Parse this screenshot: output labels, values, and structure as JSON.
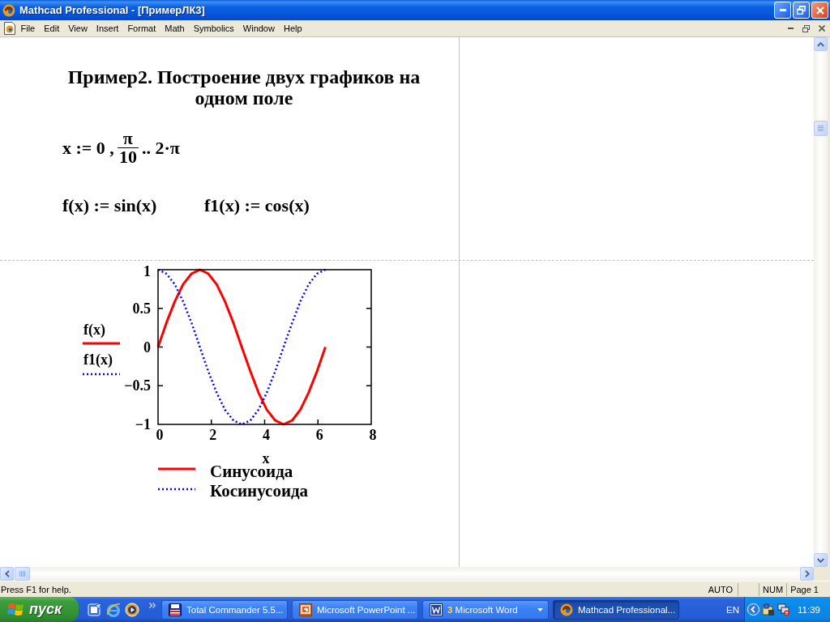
{
  "window": {
    "title": "Mathcad Professional - [ПримерЛК3]"
  },
  "menu": [
    "File",
    "Edit",
    "View",
    "Insert",
    "Format",
    "Math",
    "Symbolics",
    "Window",
    "Help"
  ],
  "worksheet": {
    "heading": "Пример2. Построение двух графиков на одном поле",
    "range_definition": {
      "prefix": "x := 0 ,",
      "numerator": "π",
      "denominator": "10",
      "suffix": ".. 2·π"
    },
    "definitions": [
      "f(x) := sin(x)",
      "f1(x) := cos(x)"
    ],
    "plot": {
      "y_axis_labels": [
        "f(x)",
        "f1(x)"
      ],
      "chart_data": {
        "type": "line",
        "xlabel": "x",
        "x": [
          0,
          0.31,
          0.63,
          0.94,
          1.26,
          1.57,
          1.88,
          2.2,
          2.51,
          2.83,
          3.14,
          3.46,
          3.77,
          4.08,
          4.4,
          4.71,
          5.03,
          5.34,
          5.65,
          5.97,
          6.28
        ],
        "series": [
          {
            "name": "Синусоида",
            "color": "#ff0000",
            "line_style": "solid",
            "values": [
              0,
              0.31,
              0.59,
              0.81,
              0.95,
              1,
              0.95,
              0.81,
              0.59,
              0.31,
              0,
              -0.31,
              -0.59,
              -0.81,
              -0.95,
              -1,
              -0.95,
              -0.81,
              -0.59,
              -0.31,
              0
            ]
          },
          {
            "name": "Косинусоида",
            "color": "#0000ff",
            "line_style": "dotted",
            "values": [
              1,
              0.95,
              0.81,
              0.59,
              0.31,
              0,
              -0.31,
              -0.59,
              -0.81,
              -0.95,
              -1,
              -0.95,
              -0.81,
              -0.59,
              -0.31,
              0,
              0.31,
              0.59,
              0.81,
              0.95,
              1
            ]
          }
        ],
        "legend": true,
        "xlim": [
          0,
          8
        ],
        "ylim": [
          -1,
          1
        ],
        "xticks": [
          0,
          2,
          4,
          6,
          8
        ],
        "yticks": [
          {
            "value": 1,
            "label": "1"
          },
          {
            "value": 0.5,
            "label": "0.5"
          },
          {
            "value": 0,
            "label": "0"
          },
          {
            "value": -0.5,
            "label": "−0.5"
          },
          {
            "value": -1,
            "label": "−1"
          }
        ]
      }
    }
  },
  "status_bar": {
    "message": "Press F1 for help.",
    "panels": [
      "AUTO",
      "NUM",
      "Page 1"
    ]
  },
  "taskbar": {
    "start_label": "пуск",
    "tasks": [
      {
        "kind": "window",
        "label": "Total Commander 5.5...",
        "selected": false
      },
      {
        "kind": "window",
        "label": "Microsoft PowerPoint ...",
        "selected": false
      },
      {
        "kind": "group",
        "count": "3",
        "label": "Microsoft Word",
        "selected": false
      },
      {
        "kind": "window",
        "label": "Mathcad Professional...",
        "selected": true
      }
    ],
    "language": "EN",
    "clock": "11:39"
  }
}
